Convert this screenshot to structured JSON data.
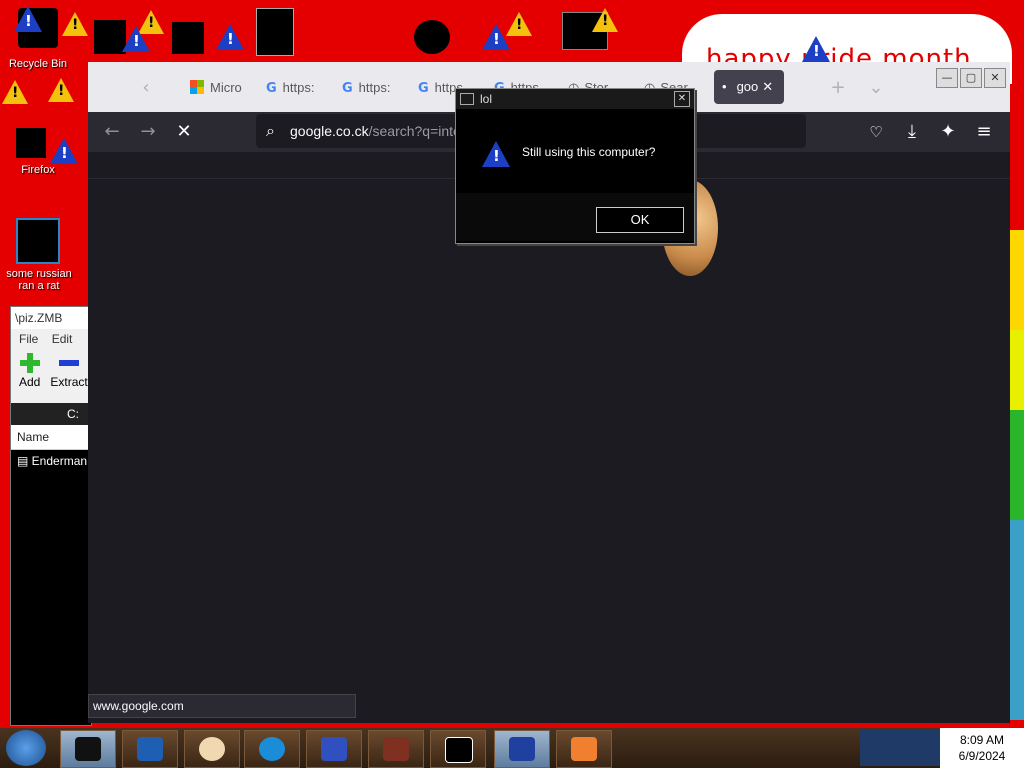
{
  "desktop": {
    "banner_text": "happy pride month",
    "icons": [
      {
        "label": "Recycle Bin"
      },
      {
        "label": "Firefox"
      },
      {
        "label": "some russian ran a rat"
      }
    ]
  },
  "sevenzip": {
    "title": "\\piz.ZMB",
    "menu": [
      "File",
      "Edit"
    ],
    "tools": [
      "Add",
      "Extract"
    ],
    "address": "C:",
    "column_name": "Name",
    "row": "Enderman"
  },
  "browser": {
    "tabs": [
      {
        "label": "Micro",
        "icon": "microsoft-icon"
      },
      {
        "label": "https:",
        "icon": "google-icon"
      },
      {
        "label": "https:",
        "icon": "google-icon"
      },
      {
        "label": "https",
        "icon": "google-icon"
      },
      {
        "label": "https",
        "icon": "google-icon"
      },
      {
        "label": "Stor",
        "icon": "clock-icon"
      },
      {
        "label": "Sear",
        "icon": "clock-icon"
      },
      {
        "label": "goo",
        "icon": "loading-dot-icon",
        "active": true
      }
    ],
    "url_main": "google.co.ck",
    "url_rest": "/search?q=inte",
    "status_text": "www.google.com"
  },
  "msgbox": {
    "title": "lol",
    "message": "Still using this computer?",
    "ok_label": "OK"
  },
  "taskbar": {
    "time": "8:09 AM",
    "date": "6/9/2024"
  },
  "colors": {
    "desktop_bg": "#e40000",
    "browser_bg": "#1c1b22",
    "taskbar_bg": "#3a2614"
  }
}
